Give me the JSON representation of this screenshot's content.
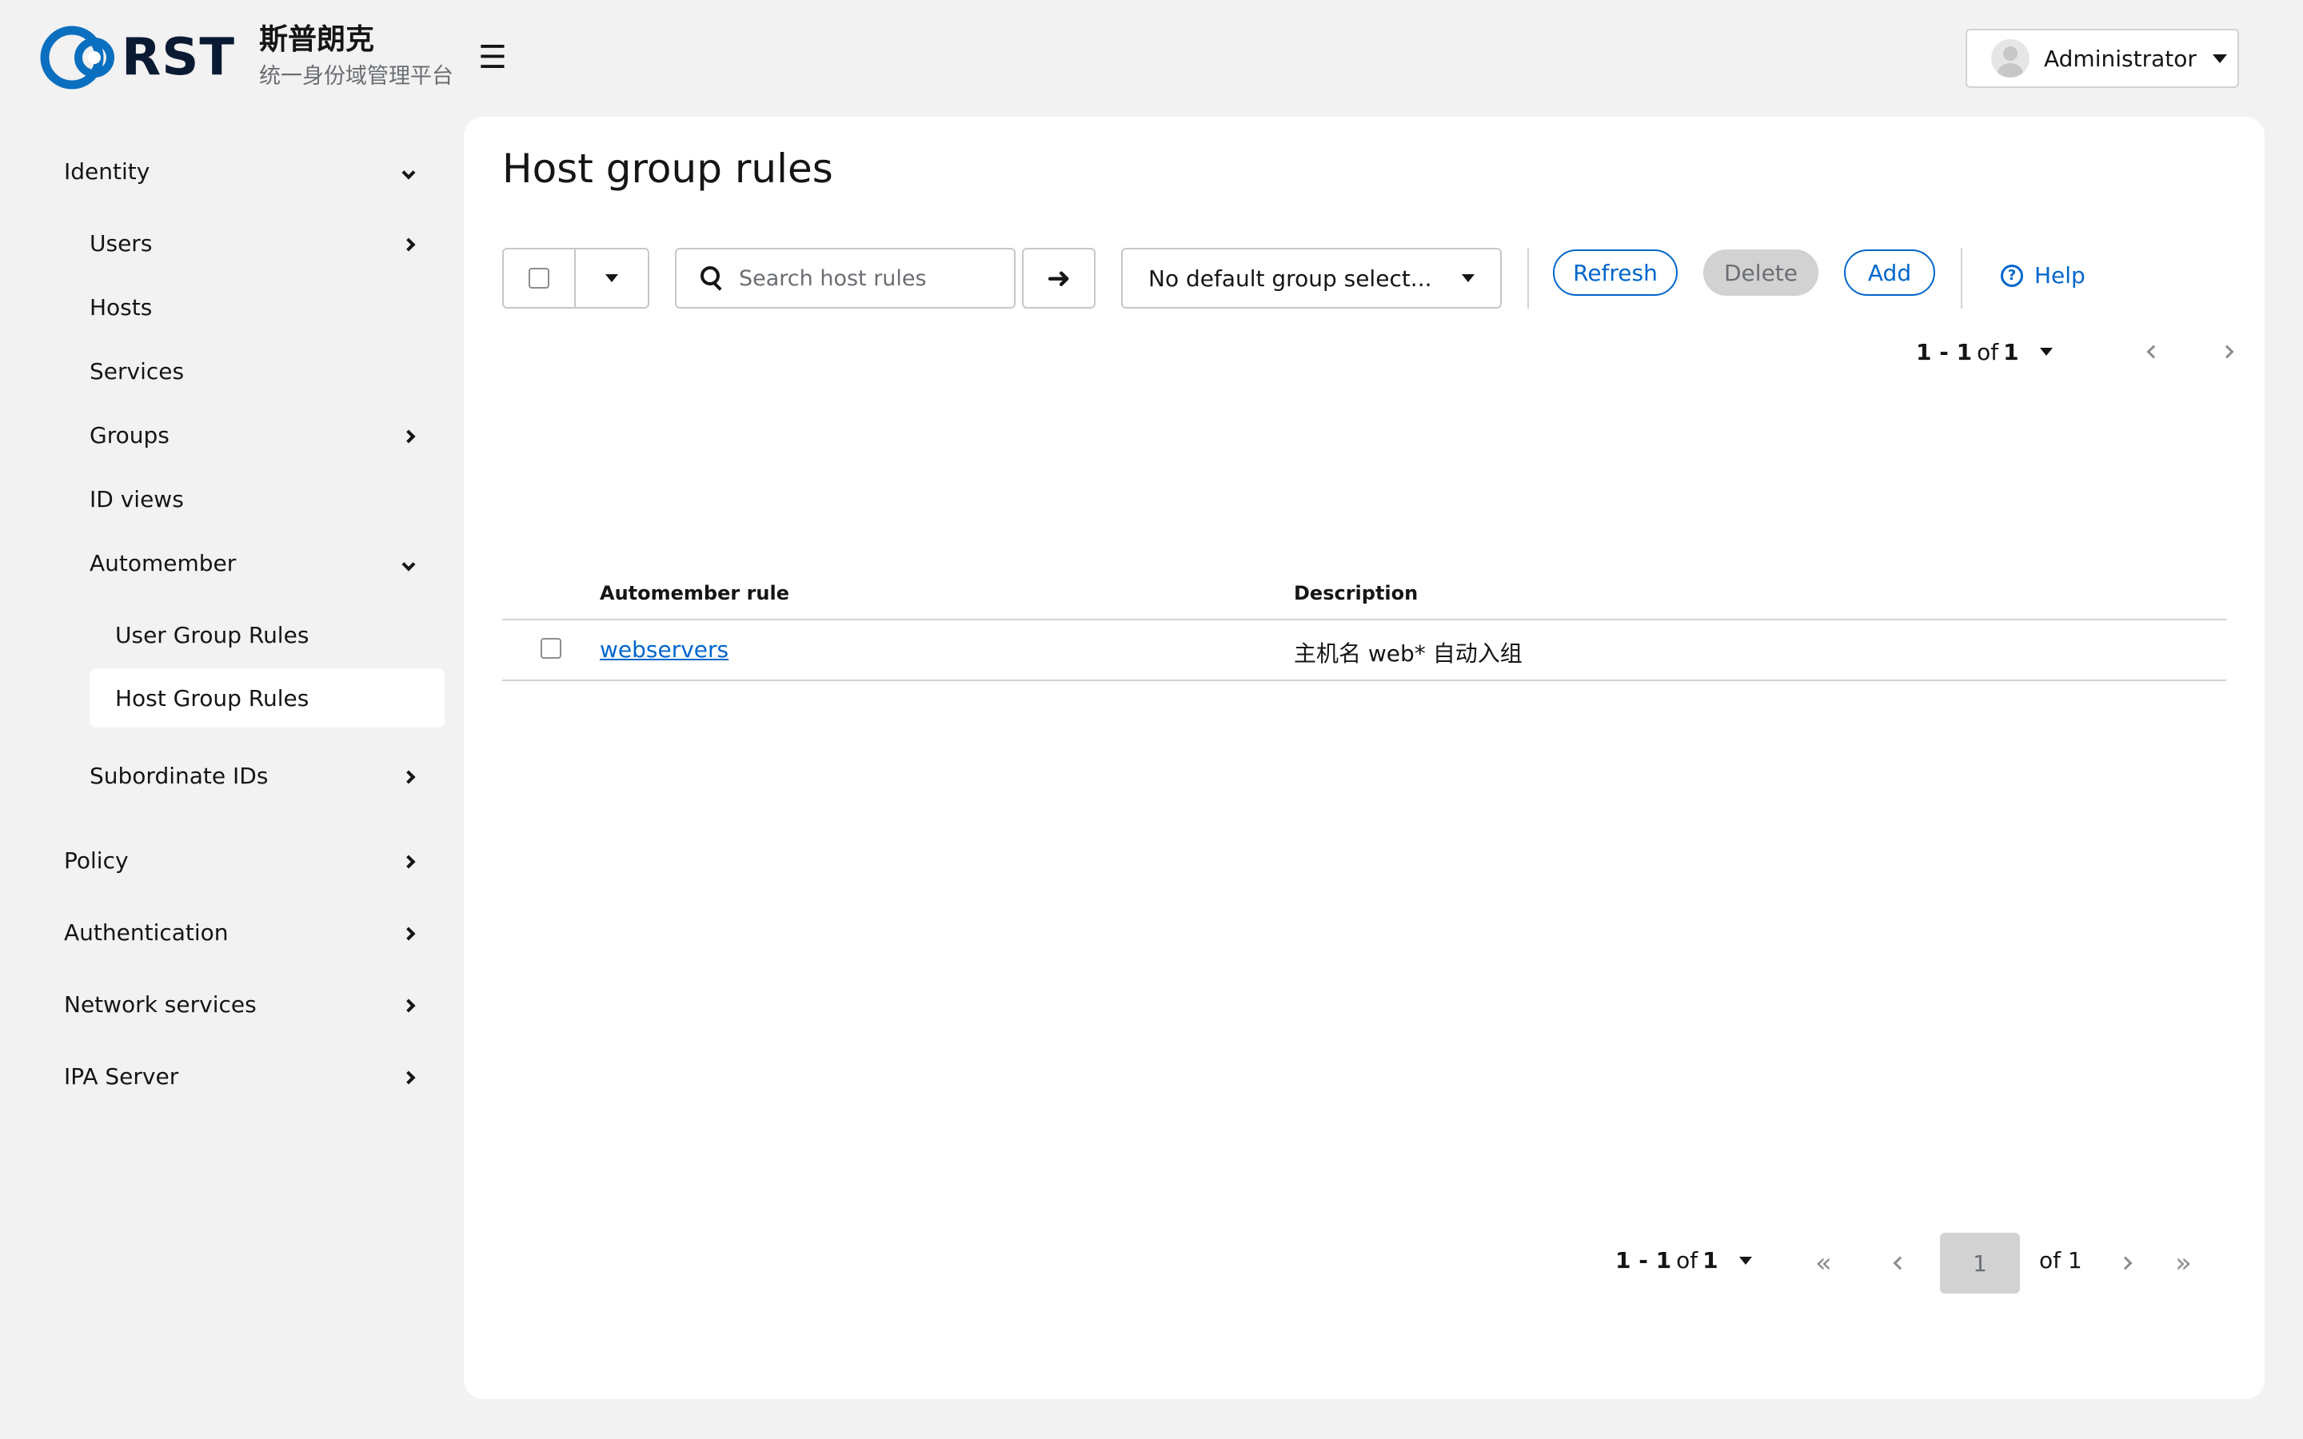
{
  "brand": {
    "logo_text": "RST",
    "name_cn": "斯普朗克",
    "subtitle_cn": "统一身份域管理平台"
  },
  "header": {
    "menu_icon": "☰",
    "user_name": "Administrator"
  },
  "sidebar": {
    "items": [
      {
        "label": "Identity",
        "icon": "chevron-down"
      },
      {
        "label": "Users",
        "icon": "chevron-right"
      },
      {
        "label": "Hosts"
      },
      {
        "label": "Services"
      },
      {
        "label": "Groups",
        "icon": "chevron-right"
      },
      {
        "label": "ID views"
      },
      {
        "label": "Automember",
        "icon": "chevron-down"
      },
      {
        "label": "User Group Rules"
      },
      {
        "label": "Host Group Rules",
        "active": true
      },
      {
        "label": "Subordinate IDs",
        "icon": "chevron-right"
      },
      {
        "label": "Policy",
        "icon": "chevron-right"
      },
      {
        "label": "Authentication",
        "icon": "chevron-right"
      },
      {
        "label": "Network services",
        "icon": "chevron-right"
      },
      {
        "label": "IPA Server",
        "icon": "chevron-right"
      }
    ]
  },
  "main": {
    "title": "Host group rules",
    "search_placeholder": "Search host rules",
    "default_group": "No default group select...",
    "buttons": {
      "refresh": "Refresh",
      "delete": "Delete",
      "add": "Add",
      "help": "Help"
    },
    "pagination": {
      "range": "1 - 1",
      "of": "of",
      "total": "1",
      "page": "1",
      "of_pages": "of 1"
    },
    "table": {
      "columns": [
        "Automember rule",
        "Description"
      ],
      "rows": [
        {
          "rule": "webservers",
          "description": "主机名 web* 自动入组"
        }
      ]
    }
  },
  "colors": {
    "accent": "#0066cc",
    "background": "#f2f2f2",
    "card": "#ffffff",
    "logo_blue": "#0b6fc0"
  }
}
